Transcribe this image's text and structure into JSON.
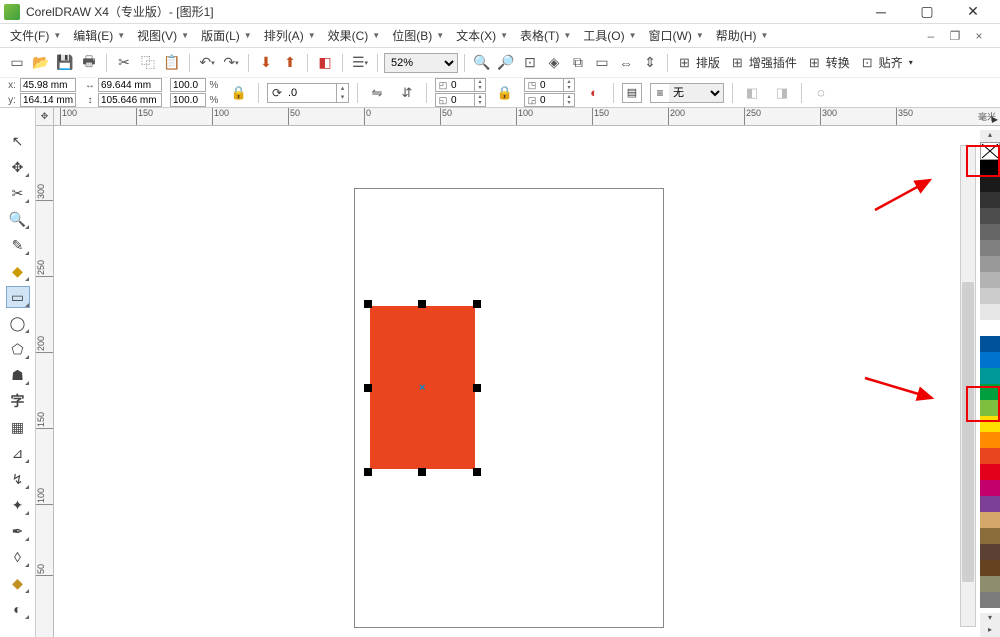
{
  "title": "CorelDRAW X4（专业版）- [图形1]",
  "menu": {
    "items": [
      "文件(F)",
      "编辑(E)",
      "视图(V)",
      "版面(L)",
      "排列(A)",
      "效果(C)",
      "位图(B)",
      "文本(X)",
      "表格(T)",
      "工具(O)",
      "窗口(W)",
      "帮助(H)"
    ]
  },
  "toolbar1": {
    "zoom_level": "52%",
    "groups": [
      "排版",
      "增强插件",
      "转换",
      "贴齐"
    ]
  },
  "property_bar": {
    "x": "45.98 mm",
    "y": "164.14 mm",
    "w": "69.644 mm",
    "h": "105.646 mm",
    "scale_x": "100.0",
    "scale_y": "100.0",
    "rotation": ".0",
    "corner_a": "0",
    "corner_b": "0",
    "corner_c": "0",
    "corner_d": "0",
    "outline": "无"
  },
  "ruler_h": {
    "ticks": [
      "100",
      "150",
      "200",
      "250",
      "300",
      "350"
    ],
    "left_ticks": [
      "50",
      "0",
      "50",
      "100",
      "150"
    ],
    "unit": "毫米"
  },
  "ruler_v": {
    "ticks": [
      "300",
      "250",
      "200",
      "150",
      "100",
      "50"
    ]
  },
  "tools": {
    "items": [
      "pick",
      "shape",
      "crop",
      "zoom",
      "freehand",
      "smart-fill",
      "rectangle",
      "ellipse",
      "polygon",
      "basic-shapes",
      "text",
      "table",
      "dimension",
      "connector",
      "interactive",
      "eyedropper",
      "outline",
      "fill",
      "interactive-fill"
    ],
    "active": "rectangle"
  },
  "palette": {
    "colors": [
      "#000000",
      "#1a1a1a",
      "#333333",
      "#4d4d4d",
      "#666666",
      "#808080",
      "#999999",
      "#b3b3b3",
      "#cccccc",
      "#e6e6e6",
      "#ffffff",
      "#00529b",
      "#0073cf",
      "#009999",
      "#009e3d",
      "#7fbf3f",
      "#ffde00",
      "#ff8c00",
      "#ea451f",
      "#e2001a",
      "#c3006b",
      "#7d3f98",
      "#d4a76a",
      "#8a6d3b",
      "#5c4033",
      "#654321",
      "#8e8e6e",
      "#7c7c7c"
    ]
  },
  "object": {
    "fill": "#ea451f"
  }
}
